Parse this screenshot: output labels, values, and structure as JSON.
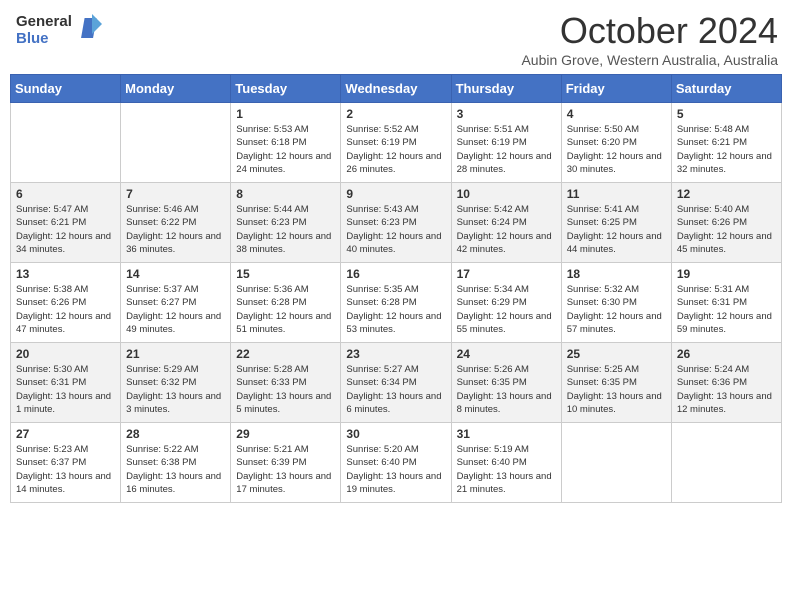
{
  "logo": {
    "line1": "General",
    "line2": "Blue"
  },
  "title": "October 2024",
  "subtitle": "Aubin Grove, Western Australia, Australia",
  "days_header": [
    "Sunday",
    "Monday",
    "Tuesday",
    "Wednesday",
    "Thursday",
    "Friday",
    "Saturday"
  ],
  "weeks": [
    [
      {
        "num": "",
        "info": ""
      },
      {
        "num": "",
        "info": ""
      },
      {
        "num": "1",
        "info": "Sunrise: 5:53 AM\nSunset: 6:18 PM\nDaylight: 12 hours and 24 minutes."
      },
      {
        "num": "2",
        "info": "Sunrise: 5:52 AM\nSunset: 6:19 PM\nDaylight: 12 hours and 26 minutes."
      },
      {
        "num": "3",
        "info": "Sunrise: 5:51 AM\nSunset: 6:19 PM\nDaylight: 12 hours and 28 minutes."
      },
      {
        "num": "4",
        "info": "Sunrise: 5:50 AM\nSunset: 6:20 PM\nDaylight: 12 hours and 30 minutes."
      },
      {
        "num": "5",
        "info": "Sunrise: 5:48 AM\nSunset: 6:21 PM\nDaylight: 12 hours and 32 minutes."
      }
    ],
    [
      {
        "num": "6",
        "info": "Sunrise: 5:47 AM\nSunset: 6:21 PM\nDaylight: 12 hours and 34 minutes."
      },
      {
        "num": "7",
        "info": "Sunrise: 5:46 AM\nSunset: 6:22 PM\nDaylight: 12 hours and 36 minutes."
      },
      {
        "num": "8",
        "info": "Sunrise: 5:44 AM\nSunset: 6:23 PM\nDaylight: 12 hours and 38 minutes."
      },
      {
        "num": "9",
        "info": "Sunrise: 5:43 AM\nSunset: 6:23 PM\nDaylight: 12 hours and 40 minutes."
      },
      {
        "num": "10",
        "info": "Sunrise: 5:42 AM\nSunset: 6:24 PM\nDaylight: 12 hours and 42 minutes."
      },
      {
        "num": "11",
        "info": "Sunrise: 5:41 AM\nSunset: 6:25 PM\nDaylight: 12 hours and 44 minutes."
      },
      {
        "num": "12",
        "info": "Sunrise: 5:40 AM\nSunset: 6:26 PM\nDaylight: 12 hours and 45 minutes."
      }
    ],
    [
      {
        "num": "13",
        "info": "Sunrise: 5:38 AM\nSunset: 6:26 PM\nDaylight: 12 hours and 47 minutes."
      },
      {
        "num": "14",
        "info": "Sunrise: 5:37 AM\nSunset: 6:27 PM\nDaylight: 12 hours and 49 minutes."
      },
      {
        "num": "15",
        "info": "Sunrise: 5:36 AM\nSunset: 6:28 PM\nDaylight: 12 hours and 51 minutes."
      },
      {
        "num": "16",
        "info": "Sunrise: 5:35 AM\nSunset: 6:28 PM\nDaylight: 12 hours and 53 minutes."
      },
      {
        "num": "17",
        "info": "Sunrise: 5:34 AM\nSunset: 6:29 PM\nDaylight: 12 hours and 55 minutes."
      },
      {
        "num": "18",
        "info": "Sunrise: 5:32 AM\nSunset: 6:30 PM\nDaylight: 12 hours and 57 minutes."
      },
      {
        "num": "19",
        "info": "Sunrise: 5:31 AM\nSunset: 6:31 PM\nDaylight: 12 hours and 59 minutes."
      }
    ],
    [
      {
        "num": "20",
        "info": "Sunrise: 5:30 AM\nSunset: 6:31 PM\nDaylight: 13 hours and 1 minute."
      },
      {
        "num": "21",
        "info": "Sunrise: 5:29 AM\nSunset: 6:32 PM\nDaylight: 13 hours and 3 minutes."
      },
      {
        "num": "22",
        "info": "Sunrise: 5:28 AM\nSunset: 6:33 PM\nDaylight: 13 hours and 5 minutes."
      },
      {
        "num": "23",
        "info": "Sunrise: 5:27 AM\nSunset: 6:34 PM\nDaylight: 13 hours and 6 minutes."
      },
      {
        "num": "24",
        "info": "Sunrise: 5:26 AM\nSunset: 6:35 PM\nDaylight: 13 hours and 8 minutes."
      },
      {
        "num": "25",
        "info": "Sunrise: 5:25 AM\nSunset: 6:35 PM\nDaylight: 13 hours and 10 minutes."
      },
      {
        "num": "26",
        "info": "Sunrise: 5:24 AM\nSunset: 6:36 PM\nDaylight: 13 hours and 12 minutes."
      }
    ],
    [
      {
        "num": "27",
        "info": "Sunrise: 5:23 AM\nSunset: 6:37 PM\nDaylight: 13 hours and 14 minutes."
      },
      {
        "num": "28",
        "info": "Sunrise: 5:22 AM\nSunset: 6:38 PM\nDaylight: 13 hours and 16 minutes."
      },
      {
        "num": "29",
        "info": "Sunrise: 5:21 AM\nSunset: 6:39 PM\nDaylight: 13 hours and 17 minutes."
      },
      {
        "num": "30",
        "info": "Sunrise: 5:20 AM\nSunset: 6:40 PM\nDaylight: 13 hours and 19 minutes."
      },
      {
        "num": "31",
        "info": "Sunrise: 5:19 AM\nSunset: 6:40 PM\nDaylight: 13 hours and 21 minutes."
      },
      {
        "num": "",
        "info": ""
      },
      {
        "num": "",
        "info": ""
      }
    ]
  ]
}
